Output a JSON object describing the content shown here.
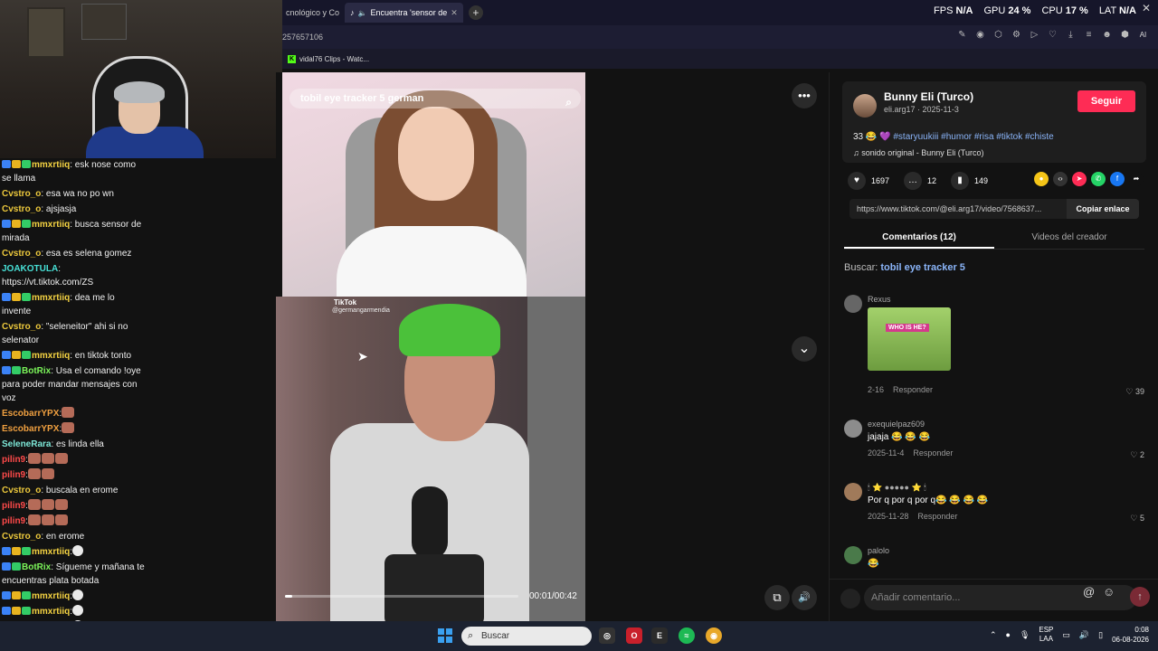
{
  "browser": {
    "tabs": [
      {
        "label": "cnológico y Co",
        "active": false
      },
      {
        "label": "Encuentra 'sensor de",
        "active": true
      }
    ],
    "new_tab": "+",
    "stats": {
      "fps_label": "FPS",
      "fps": "N/A",
      "gpu_label": "GPU",
      "gpu": "24 %",
      "cpu_label": "CPU",
      "cpu": "17 %",
      "lat_label": "LAT",
      "lat": "N/A"
    },
    "close": "✕",
    "url": "257657106",
    "ai_label": "AI",
    "bookmark": {
      "label": "vidal76 Clips - Watc...",
      "favicon": "K"
    }
  },
  "chat": {
    "messages": [
      {
        "user": "mmxrtiiq",
        "color": "#f5d342",
        "text": ": esk nose como se llama",
        "badges": [
          "#3b82f6",
          "#e8b420",
          "#33cc66"
        ]
      },
      {
        "user": "Cvstro_o",
        "color": "#ecc83c",
        "text": ": esa wa no po wn",
        "badges": []
      },
      {
        "user": "Cvstro_o",
        "color": "#ecc83c",
        "text": ": ajsjasja",
        "badges": []
      },
      {
        "user": "mmxrtiiq",
        "color": "#f5d342",
        "text": ": busca sensor de mirada",
        "badges": [
          "#3b82f6",
          "#e8b420",
          "#33cc66"
        ]
      },
      {
        "user": "Cvstro_o",
        "color": "#ecc83c",
        "text": ": esa es selena gomez",
        "badges": []
      },
      {
        "user": "JOAKOTULA",
        "color": "#47e0d6",
        "text": ": https://vt.tiktok.com/ZS",
        "badges": []
      },
      {
        "user": "mmxrtiiq",
        "color": "#f5d342",
        "text": ": dea me lo invente",
        "badges": [
          "#3b82f6",
          "#e8b420",
          "#33cc66"
        ]
      },
      {
        "user": "Cvstro_o",
        "color": "#ecc83c",
        "text": ": \"seleneitor\" ahi si no selenator",
        "badges": []
      },
      {
        "user": "mmxrtiiq",
        "color": "#f5d342",
        "text": ": en tiktok tonto",
        "badges": [
          "#3b82f6",
          "#e8b420",
          "#33cc66"
        ]
      },
      {
        "user": "BotRix",
        "color": "#7cf55a",
        "text": ": Usa el comando !oye para poder mandar mensajes con voz",
        "badges": [
          "#3b82f6",
          "#33cc66"
        ]
      },
      {
        "user": "EscobarrYPX",
        "color": "#f0a040",
        "text": ":",
        "badges": [],
        "emotes": 1
      },
      {
        "user": "EscobarrYPX",
        "color": "#f0a040",
        "text": ":",
        "badges": [],
        "emotes": 1
      },
      {
        "user": "SeleneRara",
        "color": "#7ee8d8",
        "text": ": es linda ella",
        "badges": []
      },
      {
        "user": "pilin9",
        "color": "#ff4a4a",
        "text": ":",
        "badges": [],
        "emotes": 3
      },
      {
        "user": "pilin9",
        "color": "#ff4a4a",
        "text": ":",
        "badges": [],
        "emotes": 2
      },
      {
        "user": "Cvstro_o",
        "color": "#ecc83c",
        "text": ": buscala en erome",
        "badges": []
      },
      {
        "user": "pilin9",
        "color": "#ff4a4a",
        "text": ":",
        "badges": [],
        "emotes": 3
      },
      {
        "user": "pilin9",
        "color": "#ff4a4a",
        "text": ":",
        "badges": [],
        "emotes": 3
      },
      {
        "user": "Cvstro_o",
        "color": "#ecc83c",
        "text": ": en erome",
        "badges": []
      },
      {
        "user": "mmxrtiiq",
        "color": "#f5d342",
        "text": ":",
        "badges": [
          "#3b82f6",
          "#e8b420",
          "#33cc66"
        ],
        "emotes": 1,
        "face": true
      },
      {
        "user": "BotRix",
        "color": "#7cf55a",
        "text": ": Sígueme y mañana te encuentras plata botada",
        "badges": [
          "#3b82f6",
          "#33cc66"
        ]
      },
      {
        "user": "mmxrtiiq",
        "color": "#f5d342",
        "text": ":",
        "badges": [
          "#3b82f6",
          "#e8b420",
          "#33cc66"
        ],
        "emotes": 1,
        "face": true
      },
      {
        "user": "mmxrtiiq",
        "color": "#f5d342",
        "text": ":",
        "badges": [
          "#3b82f6",
          "#e8b420",
          "#33cc66"
        ],
        "emotes": 1,
        "face": true
      },
      {
        "user": "mmxrtiiq",
        "color": "#f5d342",
        "text": ":",
        "badges": [
          "#3b82f6",
          "#e8b420",
          "#33cc66"
        ],
        "emotes": 1,
        "face": true
      }
    ]
  },
  "video": {
    "search_overlay": "tobil eye tracker 5 german",
    "watermark": "TikTok",
    "watermark_user": "@germangarmendia",
    "time": "00:01/00:42",
    "progress": 0.03,
    "more_icon": "•••",
    "down_icon": "⌄",
    "mute_icon": "🔊",
    "pip_icon": "⧉"
  },
  "panel": {
    "creator": {
      "name": "Bunny Eli (Turco)",
      "meta": "eli.arg17 · 2025-11-3",
      "follow": "Seguir"
    },
    "description": {
      "prefix": "33 😂 💜 ",
      "tags": "#staryuukiii #humor #risa #tiktok #chiste"
    },
    "sound": "♫  sonido original - Bunny Eli (Turco)",
    "actions": {
      "likes": "1697",
      "comments": "12",
      "saves": "149"
    },
    "share_colors": [
      "#f5c518",
      "#333333",
      "#fe2c55",
      "#25d366",
      "#1877f2",
      "#121212"
    ],
    "link": "https://www.tiktok.com/@eli.arg17/video/7568637...",
    "copy": "Copiar enlace",
    "tabs": [
      "Comentarios (12)",
      "Videos del creador"
    ],
    "search_label": "Buscar:",
    "search_query": "tobil eye tracker 5",
    "comments": [
      {
        "user": "Rexus",
        "text": "",
        "date": "2-16",
        "reply": "Responder",
        "likes": "39",
        "image_label": "WHO IS HE?"
      },
      {
        "user": "exequielpaz609",
        "text": "jajaja 😂 😂 😂",
        "date": "2025-11-4",
        "reply": "Responder",
        "likes": "2"
      },
      {
        "user": "🕯 ⭐ ●●●●● ⭐ 🕯",
        "text": "Por q por q por q😂 😂 😂 😂",
        "date": "2025-11-28",
        "reply": "Responder",
        "likes": "5"
      },
      {
        "user": "palolo",
        "text": "😂",
        "date": "",
        "reply": "",
        "likes": ""
      }
    ],
    "add_comment_placeholder": "Añadir comentario..."
  },
  "taskbar": {
    "search": "Buscar",
    "lang": "ESP",
    "lang2": "LAA",
    "time": "0:08",
    "date": "06-08-2026"
  }
}
